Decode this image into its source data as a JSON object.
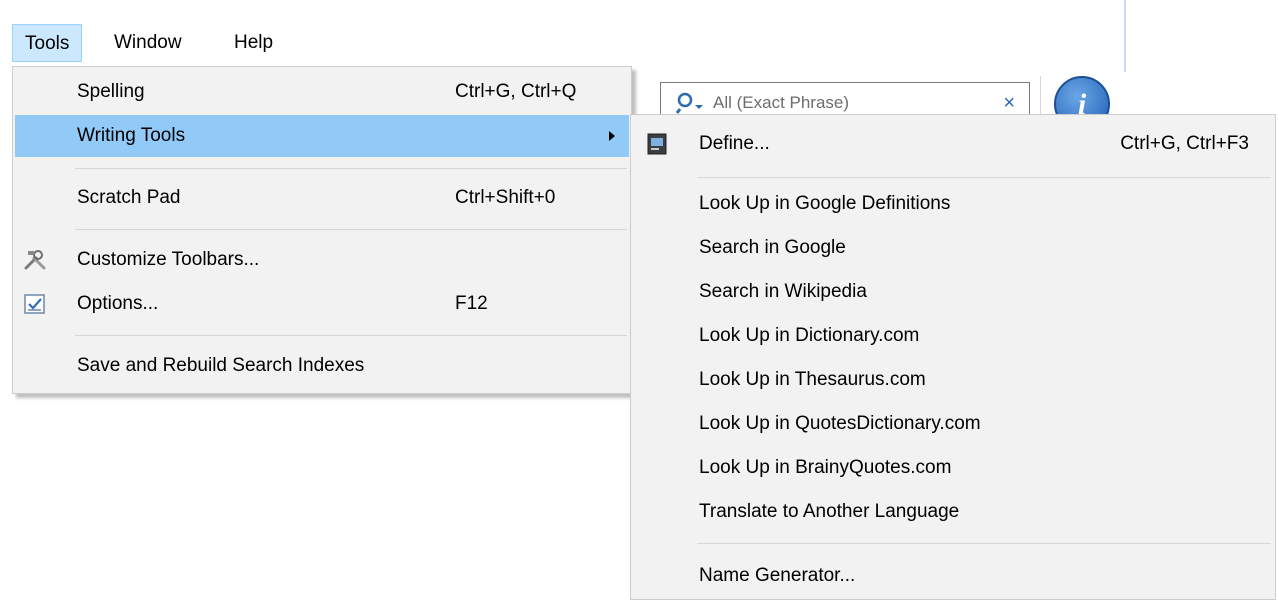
{
  "menubar": {
    "items": [
      {
        "label": "Tools"
      },
      {
        "label": "Window"
      },
      {
        "label": "Help"
      }
    ]
  },
  "toolbar": {
    "search_placeholder": "All (Exact Phrase)",
    "clear_glyph": "×",
    "info_glyph": "i"
  },
  "tools_menu": {
    "spelling": {
      "label": "Spelling",
      "shortcut": "Ctrl+G, Ctrl+Q"
    },
    "writing_tools": {
      "label": "Writing Tools"
    },
    "scratch_pad": {
      "label": "Scratch Pad",
      "shortcut": "Ctrl+Shift+0"
    },
    "customize_toolbars": {
      "label": "Customize Toolbars..."
    },
    "options": {
      "label": "Options...",
      "shortcut": "F12"
    },
    "save_rebuild": {
      "label": "Save and Rebuild Search Indexes"
    }
  },
  "writing_tools_menu": {
    "define": {
      "label": "Define...",
      "shortcut": "Ctrl+G, Ctrl+F3"
    },
    "items": [
      "Look Up in Google Definitions",
      "Search in Google",
      "Search in Wikipedia",
      "Look Up in Dictionary.com",
      "Look Up in Thesaurus.com",
      "Look Up in QuotesDictionary.com",
      "Look Up in BrainyQuotes.com",
      "Translate to Another Language"
    ],
    "name_generator": {
      "label": "Name Generator..."
    }
  },
  "colors": {
    "highlight": "#91c9f7",
    "menu_bg": "#f2f2f2",
    "menubar_active": "#cce8ff"
  }
}
